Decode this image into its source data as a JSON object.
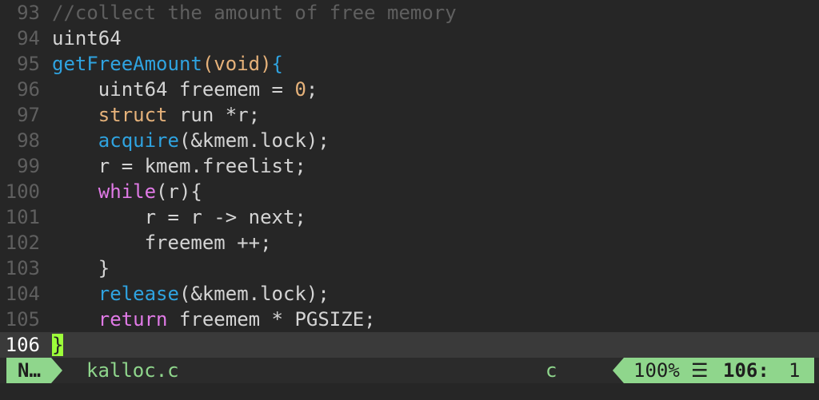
{
  "editor": {
    "lines": [
      {
        "num": "93",
        "tokens": [
          {
            "t": "//collect the amount of free memory",
            "k": "comment"
          }
        ]
      },
      {
        "num": "94",
        "tokens": [
          {
            "t": "uint64",
            "k": "plain"
          }
        ]
      },
      {
        "num": "95",
        "tokens": [
          {
            "t": "getFreeAmount",
            "k": "func"
          },
          {
            "t": "(",
            "k": "type"
          },
          {
            "t": "void",
            "k": "type"
          },
          {
            "t": ")",
            "k": "type"
          },
          {
            "t": "{",
            "k": "func"
          }
        ]
      },
      {
        "num": "96",
        "tokens": [
          {
            "t": "    uint64 freemem = ",
            "k": "plain"
          },
          {
            "t": "0",
            "k": "number"
          },
          {
            "t": ";",
            "k": "plain"
          }
        ]
      },
      {
        "num": "97",
        "tokens": [
          {
            "t": "    ",
            "k": "plain"
          },
          {
            "t": "struct",
            "k": "type"
          },
          {
            "t": " run *r;",
            "k": "plain"
          }
        ]
      },
      {
        "num": "98",
        "tokens": [
          {
            "t": "    ",
            "k": "plain"
          },
          {
            "t": "acquire",
            "k": "func"
          },
          {
            "t": "(&kmem.lock);",
            "k": "plain"
          }
        ]
      },
      {
        "num": "99",
        "tokens": [
          {
            "t": "    r = kmem.freelist;",
            "k": "plain"
          }
        ]
      },
      {
        "num": "100",
        "tokens": [
          {
            "t": "    ",
            "k": "plain"
          },
          {
            "t": "while",
            "k": "keyword"
          },
          {
            "t": "(r){",
            "k": "plain"
          }
        ]
      },
      {
        "num": "101",
        "tokens": [
          {
            "t": "        r = r -> next;",
            "k": "plain"
          }
        ]
      },
      {
        "num": "102",
        "tokens": [
          {
            "t": "        freemem ++;",
            "k": "plain"
          }
        ]
      },
      {
        "num": "103",
        "tokens": [
          {
            "t": "    }",
            "k": "plain"
          }
        ]
      },
      {
        "num": "104",
        "tokens": [
          {
            "t": "    ",
            "k": "plain"
          },
          {
            "t": "release",
            "k": "func"
          },
          {
            "t": "(&kmem.lock);",
            "k": "plain"
          }
        ]
      },
      {
        "num": "105",
        "tokens": [
          {
            "t": "    ",
            "k": "plain"
          },
          {
            "t": "return",
            "k": "keyword"
          },
          {
            "t": " freemem * PGSIZE;",
            "k": "plain"
          }
        ]
      },
      {
        "num": "106",
        "tokens": [
          {
            "t": "}",
            "k": "cursor"
          }
        ],
        "current": true
      }
    ]
  },
  "statusbar": {
    "mode": "N…",
    "filename": "kalloc.c",
    "filetype": "c",
    "percent": "100%",
    "lines_icon": "☰",
    "line": "106:",
    "col": "1"
  },
  "colors": {
    "background": "#262626",
    "accent_green": "#8fd68c",
    "cursor": "#9dff3a",
    "function": "#2fa3e0",
    "keyword": "#e07ae6",
    "type": "#e6b27a"
  }
}
